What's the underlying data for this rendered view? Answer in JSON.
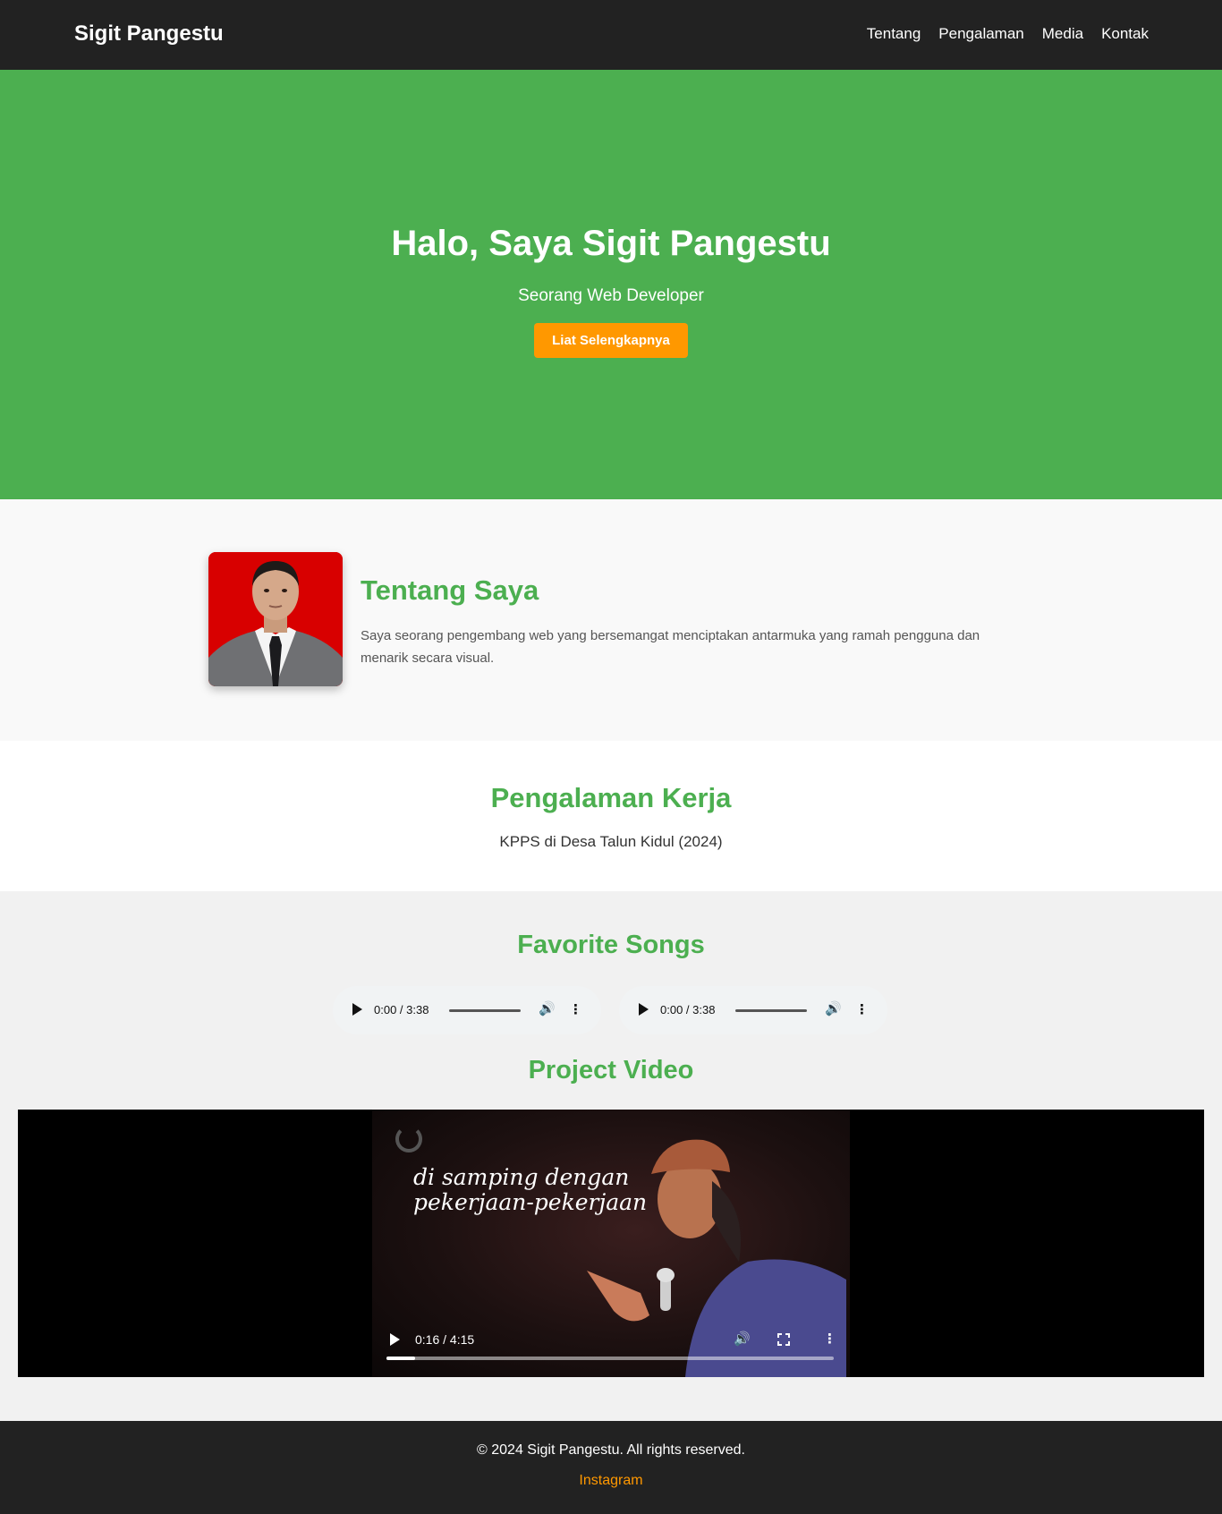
{
  "navbar": {
    "brand": "Sigit Pangestu",
    "links": [
      "Tentang",
      "Pengalaman",
      "Media",
      "Kontak"
    ]
  },
  "hero": {
    "title": "Halo, Saya Sigit Pangestu",
    "subtitle": "Seorang Web Developer",
    "button": "Liat Selengkapnya"
  },
  "about": {
    "title": "Tentang Saya",
    "text": "Saya seorang pengembang web yang bersemangat menciptakan antarmuka yang ramah pengguna dan menarik secara visual."
  },
  "experience": {
    "title": "Pengalaman Kerja",
    "item": "KPPS di Desa Talun Kidul (2024)"
  },
  "media": {
    "songs_title": "Favorite Songs",
    "songs": [
      {
        "time": "0:00 / 3:38"
      },
      {
        "time": "0:00 / 3:38"
      }
    ],
    "video_title": "Project Video",
    "video": {
      "caption_line1": "di samping dengan",
      "caption_line2": "pekerjaan-pekerjaan",
      "time": "0:16 / 4:15",
      "progress": 0.064
    }
  },
  "footer": {
    "copyright": "© 2024 Sigit Pangestu. All rights reserved.",
    "link": "Instagram"
  },
  "colors": {
    "accent": "#4caf50",
    "button": "#ff9800",
    "dark": "#222222"
  }
}
